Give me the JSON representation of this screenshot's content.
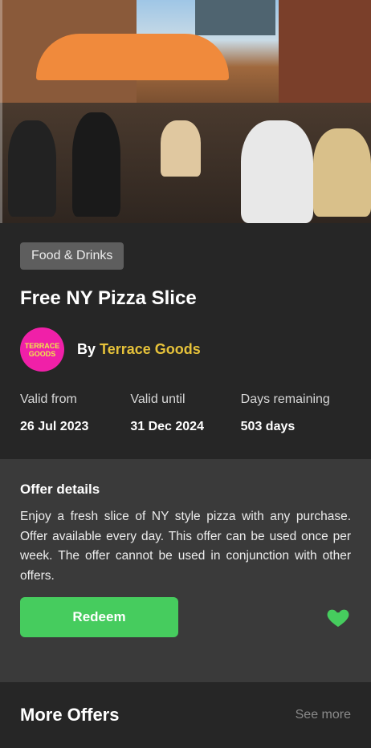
{
  "hero": {
    "image_alt": "Outdoor terrace with people dining under orange umbrellas"
  },
  "offer": {
    "category": "Food & Drinks",
    "title": "Free NY Pizza Slice",
    "by_label": "By",
    "vendor": "Terrace Goods",
    "vendor_logo_text": "TERRACE GOODS",
    "validity": [
      {
        "label": "Valid from",
        "value": "26 Jul 2023"
      },
      {
        "label": "Valid until",
        "value": "31 Dec 2024"
      },
      {
        "label": "Days remaining",
        "value": "503 days"
      }
    ]
  },
  "details": {
    "title": "Offer details",
    "text": "Enjoy a fresh slice of NY style pizza with any purchase. Offer available every day. This offer can be used once per week. The offer cannot be used in conjunction with other offers.",
    "redeem_label": "Redeem",
    "favorite_icon": "heart-icon"
  },
  "more": {
    "title": "More Offers",
    "see_more": "See more"
  },
  "colors": {
    "accent_green": "#46cc5e",
    "vendor_yellow": "#e6c23a",
    "logo_pink": "#f020a8"
  }
}
